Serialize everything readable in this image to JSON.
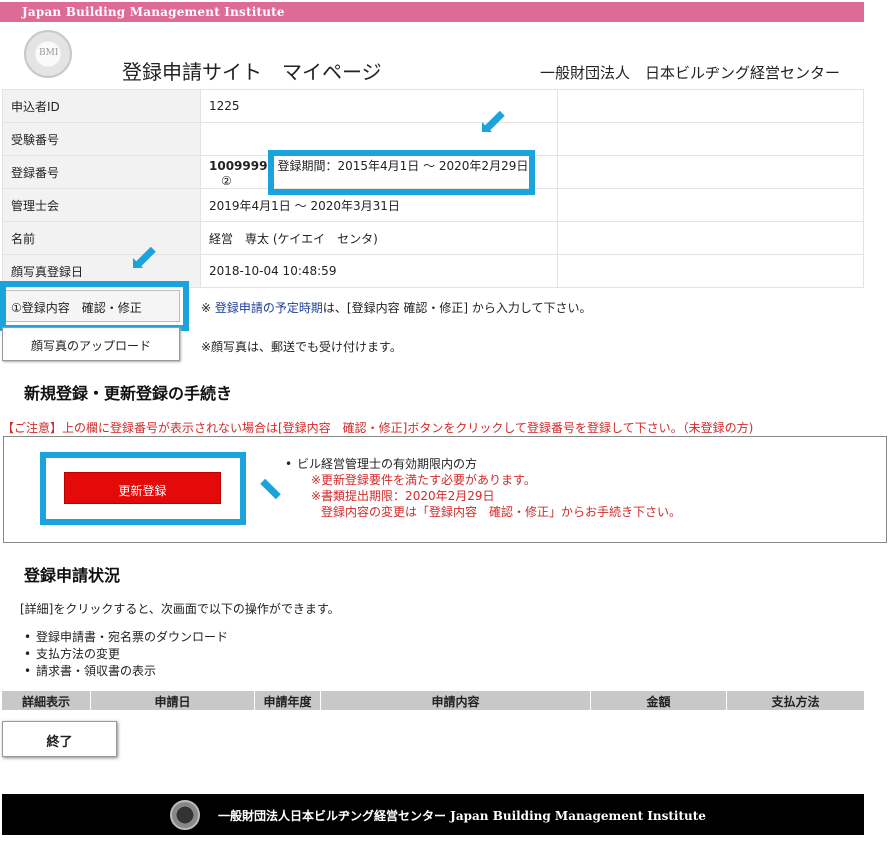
{
  "topbar": {
    "title": "Japan Building Management Institute"
  },
  "header": {
    "logo_text": "BMI",
    "site_title": "登録申請サイト　マイページ",
    "org_name": "一般財団法人　日本ビルヂング経営センター"
  },
  "info": {
    "applicant_id_label": "申込者ID",
    "applicant_id": "1225",
    "exam_number_label": "受験番号",
    "exam_number": "",
    "reg_number_label": "登録番号",
    "reg_number": "1009999",
    "reg_period": "登録期間：2015年4月1日 ～ 2020年2月29日",
    "marker_2": "②",
    "council_label": "管理士会",
    "council_period": "2019年4月1日 ～ 2020年3月31日",
    "name_label": "名前",
    "name": "経営　専太 (ケイエイ　センタ)",
    "photo_date_label": "顔写真登録日",
    "photo_date": "2018-10-04 10:48:59"
  },
  "actions": {
    "confirm_button": "①登録内容　確認・修正",
    "confirm_note_prefix": "※ ",
    "confirm_note_blue": "登録申請の予定時期",
    "confirm_note_rest": "は、[登録内容 確認・修正] から入力して下さい。",
    "photo_button": "顔写真のアップロード",
    "photo_note": "※顔写真は、郵送でも受け付けます。"
  },
  "procedure": {
    "heading": "新規登録・更新登録の手続き",
    "caution": "【ご注意】上の欄に登録番号が表示されない場合は[登録内容　確認・修正]ボタンをクリックして登録番号を登録して下さい。（未登録の方)",
    "renew_button": "更新登録",
    "bullet": "•",
    "info_1": "ビル経営管理士の有効期限内の方",
    "info_2": "※更新登録要件を満たす必要があります。",
    "info_3": "※書類提出期限：2020年2月29日",
    "info_4": "登録内容の変更は「登録内容　確認・修正」からお手続き下さい。"
  },
  "status": {
    "heading": "登録申請状況",
    "description": "[詳細]をクリックすると、次画面で以下の操作ができます。",
    "operations": [
      "登録申請書・宛名票のダウンロード",
      "支払方法の変更",
      "請求書・領収書の表示"
    ],
    "columns": [
      "詳細表示",
      "申請日",
      "申請年度",
      "申請内容",
      "金額",
      "支払方法"
    ]
  },
  "end_button": "終了",
  "footer": {
    "text": "一般財団法人日本ビルヂング経営センター Japan Building Management Institute"
  },
  "colors": {
    "accent_pink": "#de6a96",
    "highlight_blue": "#1ba3dc",
    "renew_red": "#e50a0a",
    "caution_red": "#d12a2a"
  }
}
